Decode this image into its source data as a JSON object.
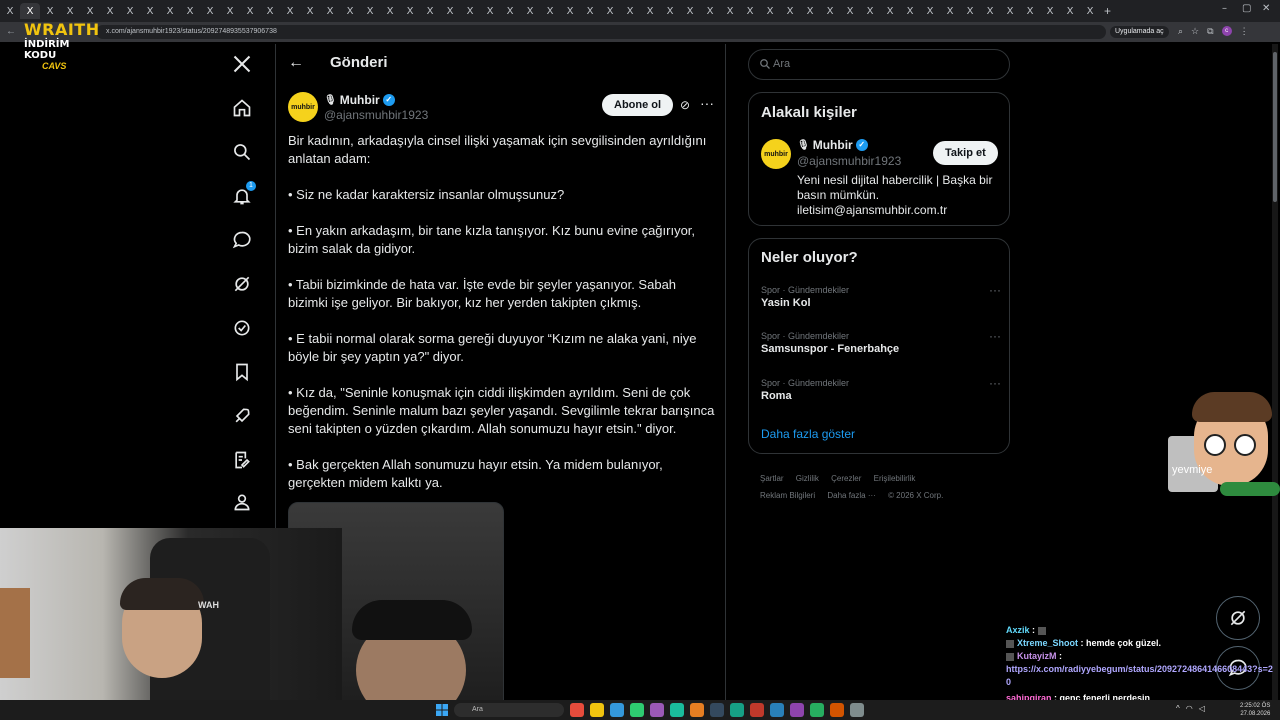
{
  "browser": {
    "tab_glyph": "X",
    "new_tab_glyph": "+",
    "url": "x.com/ajansmuhbir1923/status/2092748935537906738",
    "app_prompt": "Uygulamada aç",
    "window_controls": [
      "–",
      "▢",
      "✕"
    ],
    "profile_initial": "c"
  },
  "overlay_logo": {
    "line1": "WRAITH",
    "line2": "İNDİRİM KODU",
    "line3": "CAVS"
  },
  "left_nav": {
    "notification_count": "1",
    "items": [
      "x-logo",
      "home",
      "explore",
      "notifications",
      "messages",
      "grok",
      "verified",
      "bookmarks",
      "jobs",
      "articles",
      "profile"
    ]
  },
  "post": {
    "header_title": "Gönderi",
    "author_name": "Muhbir",
    "author_handle": "@ajansmuhbir1923",
    "avatar_text": "muhbir",
    "subscribe_label": "Abone ol",
    "paragraphs": [
      "Bir kadının, arkadaşıyla cinsel ilişki yaşamak için sevgilisinden ayrıldığını anlatan adam:",
      "• Siz ne kadar karaktersiz insanlar olmuşsunuz?",
      "• En yakın arkadaşım, bir tane kızla tanışıyor. Kız bunu evine çağırıyor, bizim salak da gidiyor.",
      "• Tabii bizimkinde de hata var. İşte evde bir şeyler yaşanıyor. Sabah bizimki işe geliyor. Bir bakıyor, kız her yerden takipten çıkmış.",
      "• E tabii normal olarak sorma gereği duyuyor “Kızım ne alaka yani, niye böyle bir şey yaptın ya?\" diyor.",
      "• Kız da, \"Seninle konuşmak için ciddi ilişkimden ayrıldım. Seni de çok beğendim. Seninle malum bazı şeyler yaşandı. Sevgilimle tekrar barışınca seni takipten o yüzden çıkardım. Allah sonumuzu hayır etsin.\" diyor.",
      "• Bak gerçekten Allah sonumuzu hayır etsin. Ya midem bulanıyor, gerçekten midem kalktı ya."
    ]
  },
  "sidebar": {
    "search_placeholder": "Ara",
    "related": {
      "title": "Alakalı kişiler",
      "name": "Muhbir",
      "handle": "@ajansmuhbir1923",
      "follow_label": "Takip et",
      "bio": "Yeni nesil dijital habercilik | Başka bir basın mümkün. iletisim@ajansmuhbir.com.tr"
    },
    "trends": {
      "title": "Neler oluyor?",
      "items": [
        {
          "meta": "Spor · Gündemdekiler",
          "name": "Yasin Kol"
        },
        {
          "meta": "Spor · Gündemdekiler",
          "name": "Samsunspor - Fenerbahçe"
        },
        {
          "meta": "Spor · Gündemdekiler",
          "name": "Roma"
        }
      ],
      "show_more": "Daha fazla göster"
    },
    "footer": [
      "Şartlar",
      "Gizlilik",
      "Çerezler",
      "Erişilebilirlik",
      "Reklam Bilgileri",
      "Daha fazla ···",
      "© 2026 X Corp."
    ]
  },
  "sticker": {
    "text": "yevmiye"
  },
  "webcam": {
    "chair_logo": "WAH"
  },
  "chat": [
    {
      "user": "Axzik",
      "message": ""
    },
    {
      "user": "Xtreme_Shoot",
      "message": "hemde çok güzel."
    },
    {
      "user": "KutayizM",
      "message": "https://x.com/radiyyebegum/status/2092724864146608443?s=20"
    },
    {
      "user": "sahipqiran",
      "message": "genç fenerli nerdesin"
    }
  ],
  "taskbar": {
    "search_placeholder": "Ara",
    "time": "2:25:02 ÖS",
    "date": "27.08.2026",
    "app_colors": [
      "#e74c3c",
      "#f1c40f",
      "#3498db",
      "#2ecc71",
      "#9b59b6",
      "#1abc9c",
      "#e67e22",
      "#34495e",
      "#16a085",
      "#c0392b",
      "#2980b9",
      "#8e44ad",
      "#27ae60",
      "#d35400",
      "#7f8c8d"
    ]
  }
}
